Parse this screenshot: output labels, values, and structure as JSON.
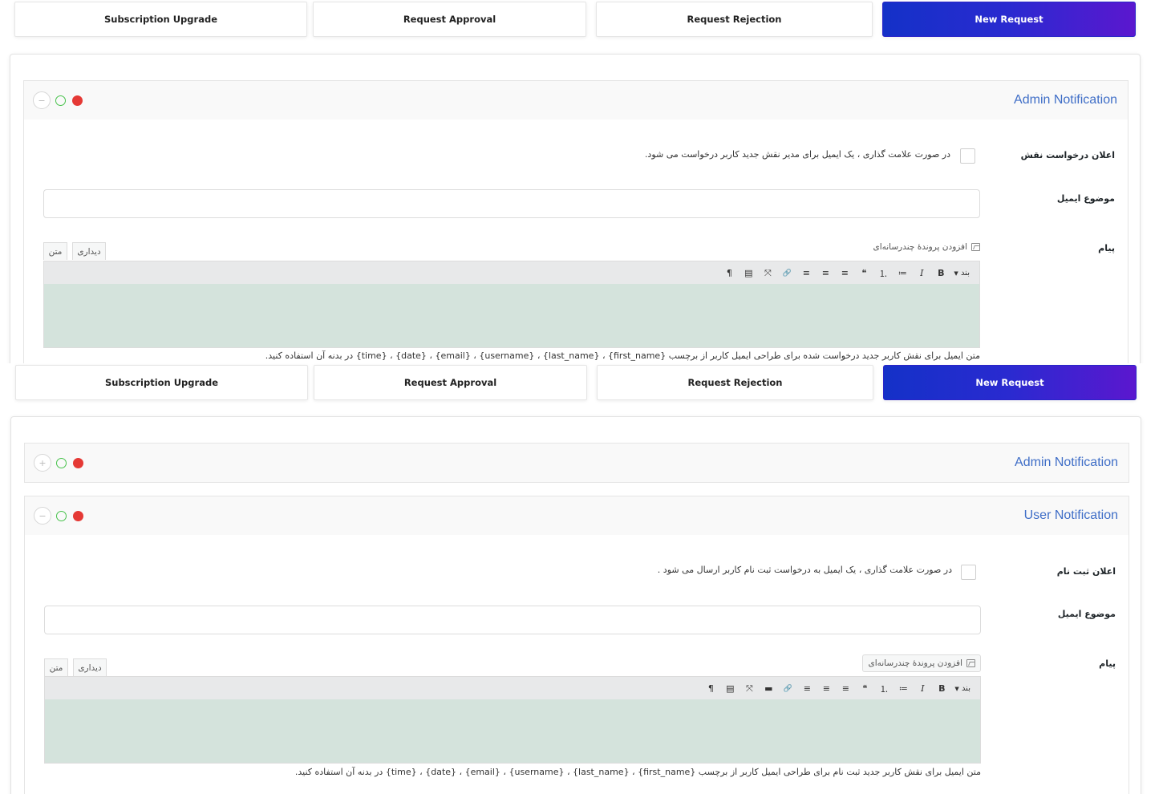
{
  "tabs": [
    {
      "label": "Subscription Upgrade"
    },
    {
      "label": "Request Approval"
    },
    {
      "label": "Request Rejection"
    },
    {
      "label": "New Request"
    }
  ],
  "admin_notification": {
    "title": "Admin Notification",
    "toggle_label": "اعلان درخواست نقش",
    "checkbox_text": "در صورت علامت گذاری ، یک ایمیل برای مدیر نقش جدید کاربر درخواست می شود.",
    "email_subject_label": "موضوع ایمیل",
    "email_subject_value": "",
    "message_label": "پیام",
    "add_media": "افزودن پروندهٔ چندرسانه‌ای",
    "tab_visual": "دیداری",
    "tab_text": "متن",
    "format_select": "بند",
    "hint": "متن ایمیل برای نقش کاربر جدید درخواست شده برای طراحی ایمیل کاربر از برچسب {first_name} ، {last_name} ، {username} ، {email} ، {date} ، {time} در بدنه آن استفاده کنید."
  },
  "user_notification": {
    "title": "User Notification",
    "toggle_label": "اعلان ثبت نام",
    "checkbox_text": "در صورت علامت گذاری ، یک ایمیل به درخواست ثبت نام کاربر ارسال می شود .",
    "email_subject_label": "موضوع ایمیل",
    "email_subject_value": "",
    "message_label": "پیام",
    "add_media": "افزودن پروندهٔ چندرسانه‌ای",
    "tab_visual": "دیداری",
    "tab_text": "متن",
    "format_select": "بند",
    "hint": "متن ایمیل برای نقش کاربر جدید ثبت نام برای طراحی ایمیل کاربر از برچسب {first_name} ، {last_name} ، {username} ، {email} ، {date} ، {time} در بدنه آن استفاده کنید."
  },
  "toolbar_icons": {
    "bold": "B",
    "italic": "I",
    "bullets": "≔",
    "numbers": "⒈",
    "quote": "❝",
    "align_left": "≡",
    "align_center": "≡",
    "align_right": "≡",
    "link": "🔗",
    "fullscreen": "⤧",
    "toolbar_toggle": "▤",
    "paragraph": "¶",
    "more": "▬"
  },
  "colors": {
    "accent_gradient_start": "#1431c8",
    "accent_gradient_end": "#5b17cf",
    "title_blue": "#3f6ec7",
    "editor_bg": "#d4e3dc",
    "status_open": "#46c24a",
    "status_close": "#e53935"
  }
}
